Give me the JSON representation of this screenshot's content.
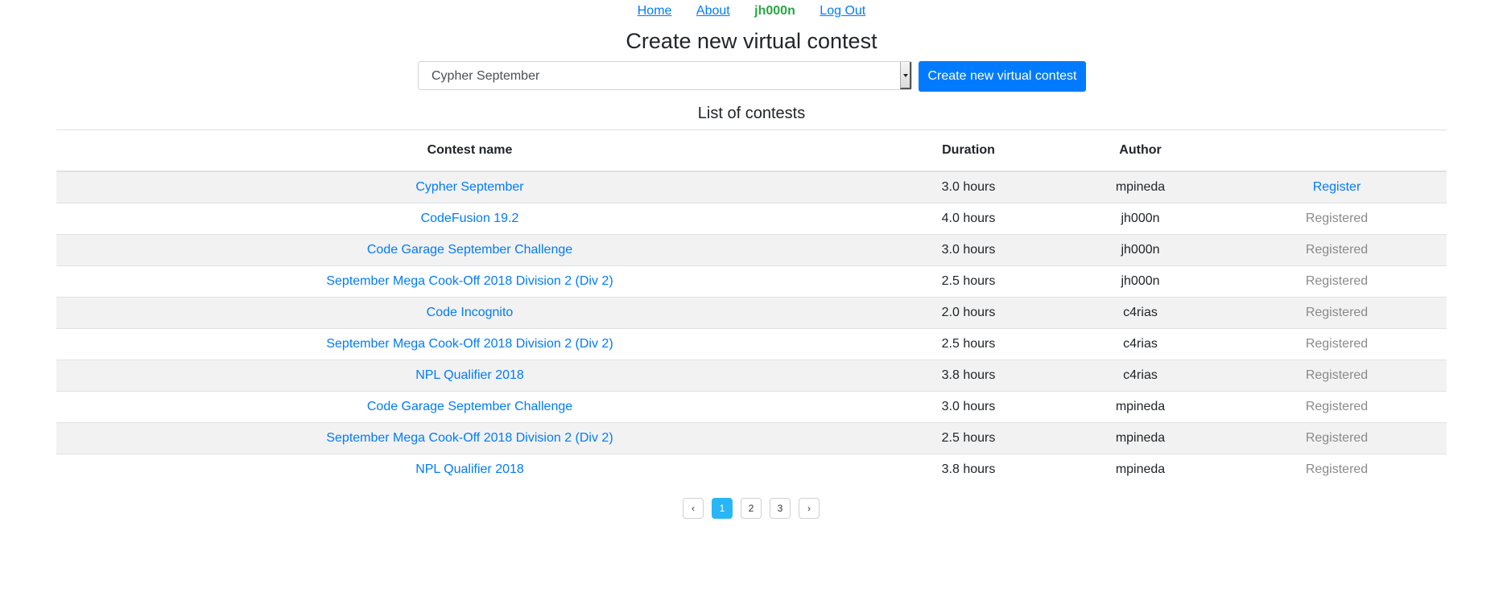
{
  "nav": {
    "home": "Home",
    "about": "About",
    "user": "jh000n",
    "logout": "Log Out"
  },
  "page_title": "Create new virtual contest",
  "create": {
    "selected_contest": "Cypher September",
    "button_label": "Create new virtual contest"
  },
  "list_title": "List of contests",
  "table": {
    "headers": {
      "name": "Contest name",
      "duration": "Duration",
      "author": "Author",
      "action": ""
    },
    "rows": [
      {
        "name": "Cypher September",
        "duration": "3.0 hours",
        "author": "mpineda",
        "action": "Register",
        "registered": false
      },
      {
        "name": "CodeFusion 19.2",
        "duration": "4.0 hours",
        "author": "jh000n",
        "action": "Registered",
        "registered": true
      },
      {
        "name": "Code Garage September Challenge",
        "duration": "3.0 hours",
        "author": "jh000n",
        "action": "Registered",
        "registered": true
      },
      {
        "name": "September Mega Cook-Off 2018 Division 2 (Div 2)",
        "duration": "2.5 hours",
        "author": "jh000n",
        "action": "Registered",
        "registered": true
      },
      {
        "name": "Code Incognito",
        "duration": "2.0 hours",
        "author": "c4rias",
        "action": "Registered",
        "registered": true
      },
      {
        "name": "September Mega Cook-Off 2018 Division 2 (Div 2)",
        "duration": "2.5 hours",
        "author": "c4rias",
        "action": "Registered",
        "registered": true
      },
      {
        "name": "NPL Qualifier 2018",
        "duration": "3.8 hours",
        "author": "c4rias",
        "action": "Registered",
        "registered": true
      },
      {
        "name": "Code Garage September Challenge",
        "duration": "3.0 hours",
        "author": "mpineda",
        "action": "Registered",
        "registered": true
      },
      {
        "name": "September Mega Cook-Off 2018 Division 2 (Div 2)",
        "duration": "2.5 hours",
        "author": "mpineda",
        "action": "Registered",
        "registered": true
      },
      {
        "name": "NPL Qualifier 2018",
        "duration": "3.8 hours",
        "author": "mpineda",
        "action": "Registered",
        "registered": true
      }
    ]
  },
  "pagination": {
    "prev": "‹",
    "pages": [
      "1",
      "2",
      "3"
    ],
    "current": "1",
    "next": "›"
  },
  "colors": {
    "link": "#007bff",
    "user": "#28a745",
    "registered": "#8a8a8a",
    "active_page": "#29b6f6",
    "stripe": "#f2f2f2"
  }
}
